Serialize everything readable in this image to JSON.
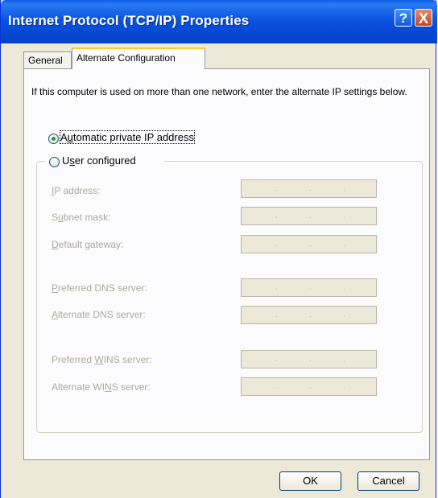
{
  "window": {
    "title": "Internet Protocol (TCP/IP) Properties",
    "help_glyph": "?",
    "close_glyph": "X"
  },
  "tabs": [
    {
      "label": "General",
      "selected": false
    },
    {
      "label": "Alternate Configuration",
      "selected": true
    }
  ],
  "description": "If this computer is used on more than one network, enter the alternate IP settings below.",
  "options": {
    "automatic": {
      "label_pre": "A",
      "label_accel": "u",
      "label_post": "tomatic private IP address",
      "selected": true
    },
    "user": {
      "label_pre": "U",
      "label_accel": "s",
      "label_post": "er configured",
      "selected": false
    }
  },
  "fields": [
    {
      "accel": "I",
      "rest": "P address:"
    },
    {
      "pre": "S",
      "accel": "u",
      "rest": "bnet mask:"
    },
    {
      "accel": "D",
      "rest": "efault gateway:"
    },
    {
      "accel": "P",
      "rest": "referred DNS server:"
    },
    {
      "accel": "A",
      "rest": "lternate DNS server:"
    },
    {
      "pre": "Preferred ",
      "accel": "W",
      "rest": "INS server:"
    },
    {
      "pre": "Alternate WI",
      "accel": "N",
      "rest": "S server:"
    }
  ],
  "ip_dot": ".",
  "buttons": {
    "ok": "OK",
    "cancel": "Cancel"
  }
}
